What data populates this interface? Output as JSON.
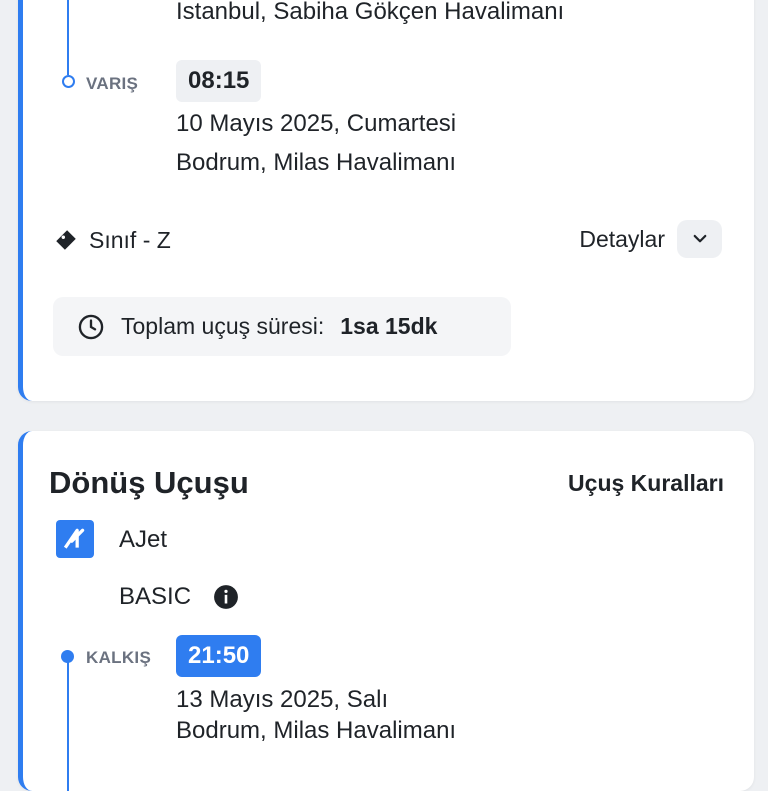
{
  "outbound": {
    "departure_airport": "İstanbul, Sabiha Gökçen Havalimanı",
    "arrival_label": "VARIŞ",
    "arrival_time": "08:15",
    "arrival_date": "10 Mayıs 2025, Cumartesi",
    "arrival_airport": "Bodrum, Milas Havalimanı",
    "class_label": "Sınıf - Z",
    "details_label": "Detaylar",
    "duration_label": "Toplam uçuş süresi:",
    "duration_value": "1sa 15dk"
  },
  "return": {
    "title": "Dönüş Uçuşu",
    "rules_label": "Uçuş Kuralları",
    "airline": "AJet",
    "fare": "BASIC",
    "departure_label": "KALKIŞ",
    "departure_time": "21:50",
    "departure_date": "13 Mayıs 2025, Salı",
    "departure_airport": "Bodrum, Milas Havalimanı"
  },
  "colors": {
    "accent": "#2f7df0",
    "background": "#eef0f3",
    "card": "#ffffff",
    "text": "#1f2328",
    "muted": "#6b7280"
  },
  "icons": [
    "ticket-icon",
    "chevron-down-icon",
    "clock-icon",
    "info-icon",
    "ajet-logo"
  ]
}
